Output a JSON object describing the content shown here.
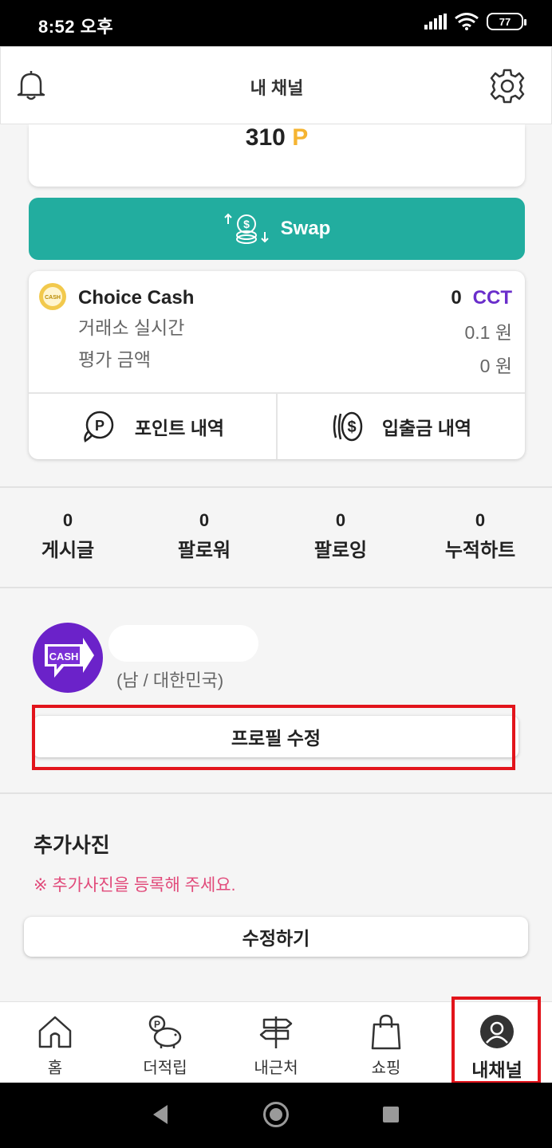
{
  "status_bar": {
    "time": "8:52 오후",
    "battery": "77"
  },
  "header": {
    "title": "내 채널"
  },
  "points": {
    "amount": "310",
    "unit": "P"
  },
  "swap": {
    "label": "Swap"
  },
  "choice_cash": {
    "name": "Choice Cash",
    "balance": "0",
    "symbol": "CCT",
    "row1_label": "거래소 실시간",
    "row1_value": "0.1  원",
    "row2_label": "평가 금액",
    "row2_value": "0  원",
    "point_history": "포인트 내역",
    "deposit_history": "입출금 내역"
  },
  "stats": [
    {
      "value": "0",
      "label": "게시글"
    },
    {
      "value": "0",
      "label": "팔로워"
    },
    {
      "value": "0",
      "label": "팔로잉"
    },
    {
      "value": "0",
      "label": "누적하트"
    }
  ],
  "profile": {
    "logo_text": "CASH",
    "meta": "(남 / 대한민국)",
    "edit_label": "프로필 수정"
  },
  "extra_photos": {
    "title": "추가사진",
    "note": "※ 추가사진을 등록해 주세요.",
    "edit_label": "수정하기"
  },
  "bottom_nav": [
    {
      "label": "홈",
      "icon": "home-icon"
    },
    {
      "label": "더적립",
      "icon": "piggy-bank-icon"
    },
    {
      "label": "내근처",
      "icon": "signpost-icon"
    },
    {
      "label": "쇼핑",
      "icon": "shopping-bag-icon"
    },
    {
      "label": "내채널",
      "icon": "user-avatar-icon",
      "active": true
    }
  ],
  "colors": {
    "accent_teal": "#22ad9f",
    "cct_purple": "#6a2ecb",
    "point_orange": "#f5b432",
    "note_pink": "#e14a7a",
    "highlight_red": "#e2141b"
  }
}
